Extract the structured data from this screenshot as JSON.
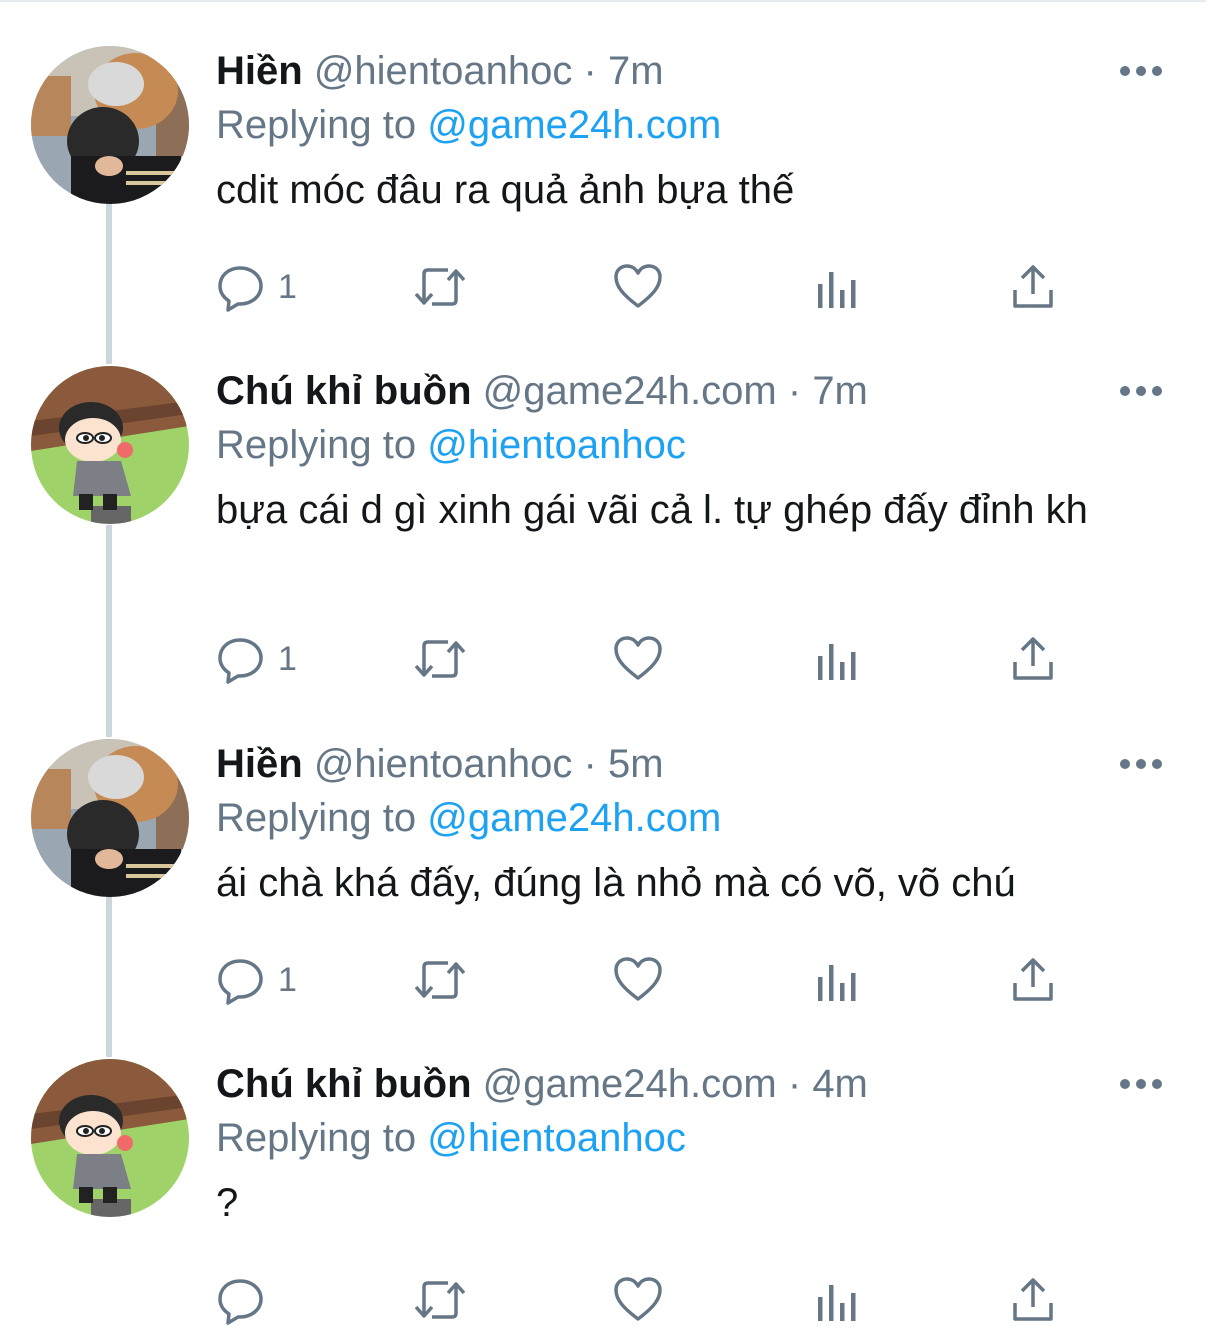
{
  "colors": {
    "text": "#14171a",
    "secondary": "#657786",
    "link": "#1da1f2",
    "thread_line": "#ccd6dd"
  },
  "icons": {
    "reply": "reply-icon",
    "retweet": "retweet-icon",
    "like": "heart-icon",
    "analytics": "analytics-icon",
    "share": "share-icon",
    "more": "more-icon"
  },
  "tweets": [
    {
      "name": "Hiền",
      "handle": "@hientoanhoc",
      "dot": "·",
      "time": "7m",
      "replying_label": "Replying to",
      "replying_to": "@game24h.com",
      "text": "cdit móc đâu ra quả ảnh bựa thế",
      "reply_count": "1"
    },
    {
      "name": "Chú khỉ buồn",
      "handle": "@game24h.com",
      "dot": "·",
      "time": "7m",
      "replying_label": "Replying to",
      "replying_to": "@hientoanhoc",
      "text": "bựa cái d gì xinh gái vãi cả l. tự ghép đấy đỉnh kh",
      "reply_count": "1"
    },
    {
      "name": "Hiền",
      "handle": "@hientoanhoc",
      "dot": "·",
      "time": "5m",
      "replying_label": "Replying to",
      "replying_to": "@game24h.com",
      "text": "ái chà khá đấy, đúng là nhỏ mà có võ, võ chú",
      "reply_count": "1"
    },
    {
      "name": "Chú khỉ buồn",
      "handle": "@game24h.com",
      "dot": "·",
      "time": "4m",
      "replying_label": "Replying to",
      "replying_to": "@hientoanhoc",
      "text": "?",
      "reply_count": ""
    }
  ]
}
